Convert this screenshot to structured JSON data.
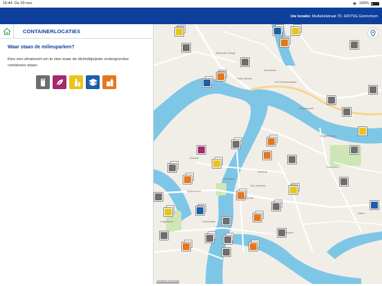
{
  "status": {
    "time": "15:44",
    "date": "Do 29 nov.",
    "battery": "100%"
  },
  "header": {
    "location_label": "Uw locatie:",
    "location_value": "Multatulistraat 70, 4207SG Gorinchem"
  },
  "panel": {
    "title": "CONTAINERLOCATIES",
    "question": "Waar staan de milieuparken?",
    "description": "Kies een afvalsoort om te zien waar de dichtsbijzijnde ondergrondse containers staan.",
    "types": [
      {
        "name": "restafval",
        "color": "#6e6e6e",
        "icon": "bin-icon"
      },
      {
        "name": "gft",
        "color": "#a6286d",
        "icon": "leaf-icon"
      },
      {
        "name": "glas",
        "color": "#e9c51a",
        "icon": "bottle-icon"
      },
      {
        "name": "papier",
        "color": "#1d5fa6",
        "icon": "paper-icon"
      },
      {
        "name": "pmd",
        "color": "#e4781f",
        "icon": "package-icon"
      }
    ]
  },
  "map": {
    "legal": "Juridische informatie",
    "labels": [
      "Merwede College",
      "Brandweer",
      "Politie Bureau",
      "Het Elzenboomland",
      "Gorinchem",
      "Jeugdherberg",
      "Visbuurt",
      "Gasthuis",
      "Waalstraat",
      "Spijkerbosch",
      "Groenmarkt",
      "Arsenaal",
      "Dalem",
      "Vrijheid",
      "Lingehaven",
      "Zeemanspad",
      "Sint Janskerk"
    ]
  }
}
